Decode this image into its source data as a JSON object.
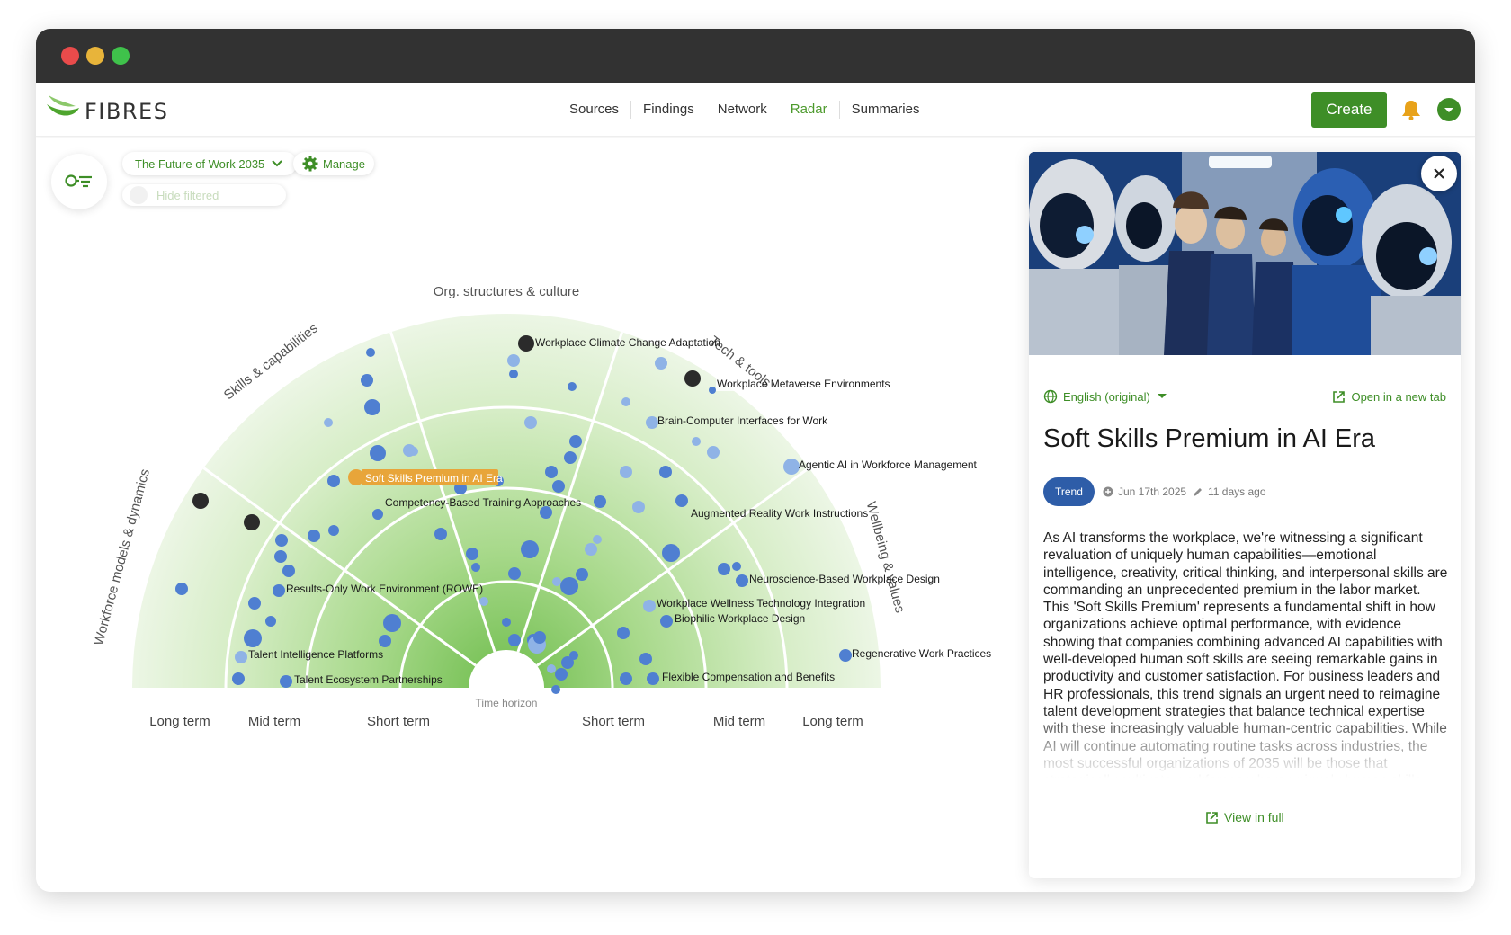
{
  "app": {
    "name": "FIBRES"
  },
  "window": {
    "controls": [
      "close",
      "minimize",
      "maximize"
    ],
    "colors": [
      "#e94b4b",
      "#e8b43a",
      "#3fc24b"
    ]
  },
  "nav": {
    "links": [
      "Sources",
      "Findings",
      "Network",
      "Radar",
      "Summaries"
    ],
    "active": "Radar",
    "create_label": "Create"
  },
  "toolbar": {
    "radar_select": "The Future of Work 2035",
    "manage_label": "Manage",
    "hide_filtered_label": "Hide filtered"
  },
  "radar": {
    "sectors": [
      "Workforce models & dynamics",
      "Skills & capabilities",
      "Org. structures & culture",
      "Tech & tools",
      "Wellbeing & values"
    ],
    "horizon_label": "Time horizon",
    "horizons_left": [
      "Long term",
      "Mid term",
      "Short term"
    ],
    "horizons_right": [
      "Short term",
      "Mid term",
      "Long term"
    ],
    "selected": "Soft Skills Premium in AI Era",
    "labels": [
      "Workplace Climate Change Adaptation",
      "Workplace Metaverse Environments",
      "Brain-Computer Interfaces for Work",
      "Agentic AI in Workforce Management",
      "Soft Skills Premium in AI Era",
      "Competency-Based Training Approaches",
      "Augmented Reality Work Instructions",
      "Neuroscience-Based Workplace Design",
      "Results-Only Work Environment (ROWE)",
      "Workplace Wellness Technology Integration",
      "Biophilic Workplace Design",
      "Talent Intelligence Platforms",
      "Regenerative Work Practices",
      "Talent Ecosystem Partnerships",
      "Flexible Compensation and Benefits"
    ],
    "colors": {
      "dot": "#4f7fd1",
      "dot_light": "#8fb3e6",
      "dark": "#2b2b2b",
      "selected": "#e8a53a",
      "ring_fill": "#c9e6b0"
    }
  },
  "panel": {
    "language": "English (original)",
    "open_new_tab": "Open in a new tab",
    "title": "Soft Skills Premium in AI Era",
    "badge": "Trend",
    "date": "Jun 17th 2025",
    "edited": "11 days ago",
    "description": "As AI transforms the workplace, we're witnessing a significant revaluation of uniquely human capabilities—emotional intelligence, creativity, critical thinking, and interpersonal skills are commanding an unprecedented premium in the labor market. This 'Soft Skills Premium' represents a fundamental shift in how organizations achieve optimal performance, with evidence showing that companies combining advanced AI capabilities with well-developed human soft skills are seeing remarkable gains in productivity and customer satisfaction. For business leaders and HR professionals, this trend signals an urgent need to reimagine talent development strategies that balance technical expertise with these increasingly valuable human-centric capabilities. While AI will continue automating routine tasks across industries, the most successful organizations of 2035 will be those that strategically cultivate workforces where uniquely human skills complement and enhance technological capabilities, creating new roles at this",
    "view_full": "View in full"
  }
}
